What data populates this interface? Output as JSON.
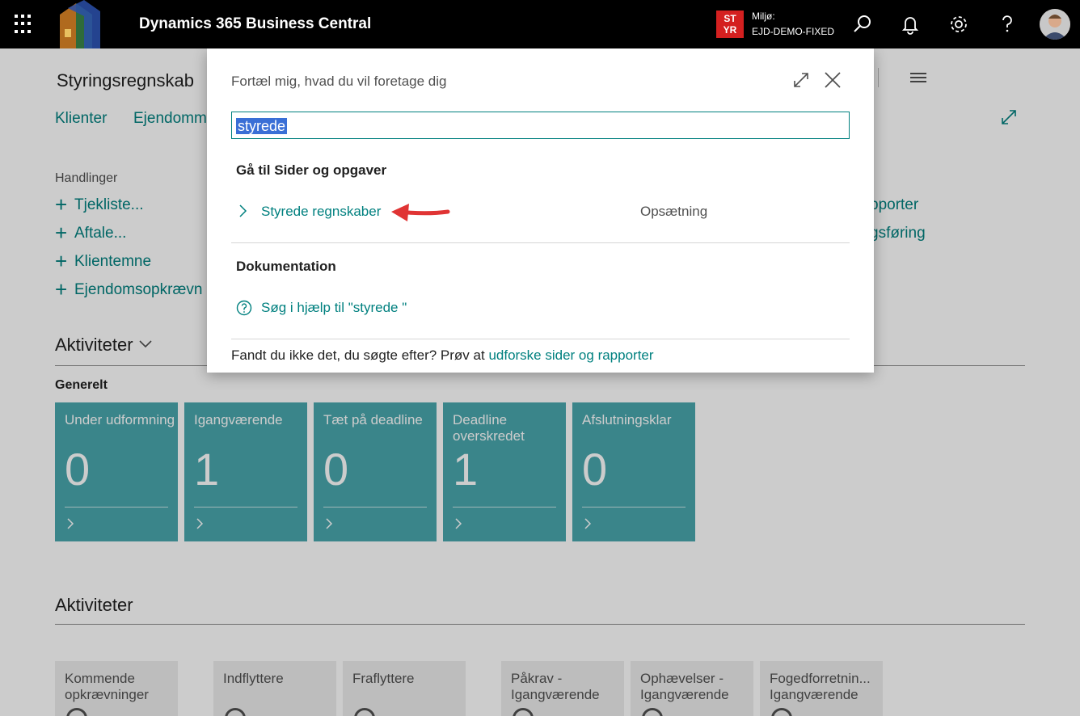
{
  "topbar": {
    "app_title": "Dynamics 365 Business Central",
    "env_badge_line1": "ST",
    "env_badge_line2": "YR",
    "env_label": "Miljø:",
    "env_name": "EJD-DEMO-FIXED",
    "icons": [
      "waffle-icon",
      "logo",
      "search-icon",
      "bell-icon",
      "gear-icon",
      "help-icon",
      "avatar"
    ],
    "badge_color": "#d42020"
  },
  "page": {
    "title": "Styringsregnskab",
    "nav": [
      "Klienter",
      "Ejendomm"
    ],
    "actions_label": "Handlinger",
    "actions": [
      "Tjekliste...",
      "Aftale...",
      "Klientemne",
      "Ejendomsopkrævn"
    ],
    "right_links": [
      "pporter",
      "gsføring"
    ],
    "activities_heading": "Aktiviteter",
    "general_label": "Generelt",
    "tiles": [
      {
        "label": "Under udformning",
        "value": "0"
      },
      {
        "label": "Igangværende",
        "value": "1"
      },
      {
        "label": "Tæt på deadline",
        "value": "0"
      },
      {
        "label": "Deadline overskredet",
        "value": "1"
      },
      {
        "label": "Afslutningsklar",
        "value": "0"
      }
    ],
    "activities_heading_2": "Aktiviteter",
    "gray_tiles": [
      {
        "label": "Kommende opkrævninger"
      },
      {
        "label": "Indflyttere"
      },
      {
        "label": "Fraflyttere"
      },
      {
        "label": "Påkrav - Igangværende"
      },
      {
        "label": "Ophævelser - Igangværende"
      },
      {
        "label": "Fogedforretnin... Igangværende"
      }
    ],
    "tile_color": "#49a7ad",
    "accent_color": "#00807f"
  },
  "dialog": {
    "title": "Fortæl mig, hvad du vil foretage dig",
    "search_value": "styrede",
    "group_pages": "Gå til Sider og opgaver",
    "result_label": "Styrede regnskaber",
    "result_category": "Opsætning",
    "group_docs": "Dokumentation",
    "help_link": "Søg i hjælp til \"styrede \"",
    "footer_prefix": "Fandt du ikke det, du søgte efter? Prøv at ",
    "footer_link": "udforske sider og rapporter"
  }
}
